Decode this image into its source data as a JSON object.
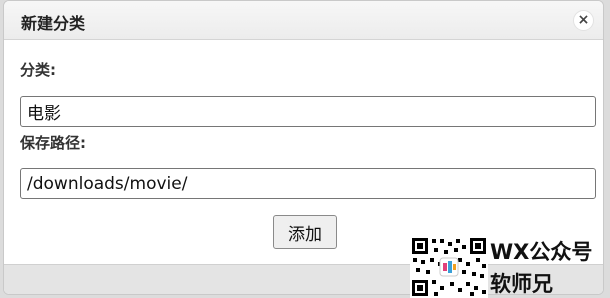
{
  "dialog": {
    "title": "新建分类",
    "close_glyph": "×",
    "category_label": "分类:",
    "category_value": "电影",
    "path_label": "保存路径:",
    "path_value": "/downloads/movie/",
    "add_label": "添加"
  },
  "watermark": {
    "line1": "WX公众号",
    "line2": "软师兄",
    "icon": "qr-code-icon"
  }
}
